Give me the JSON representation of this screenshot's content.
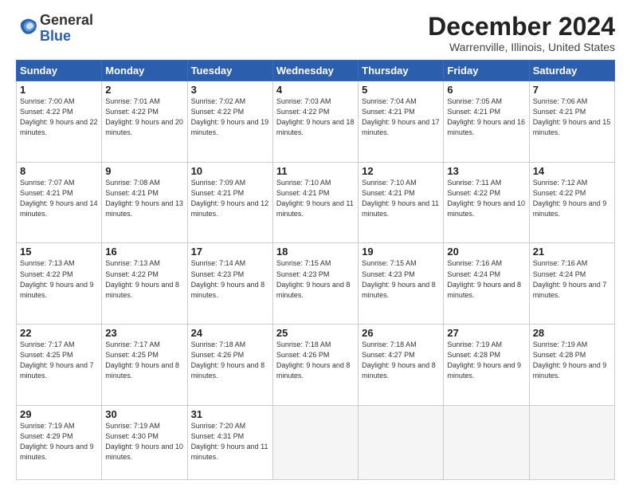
{
  "logo": {
    "general": "General",
    "blue": "Blue"
  },
  "title": "December 2024",
  "subtitle": "Warrenville, Illinois, United States",
  "headers": [
    "Sunday",
    "Monday",
    "Tuesday",
    "Wednesday",
    "Thursday",
    "Friday",
    "Saturday"
  ],
  "weeks": [
    [
      {
        "day": "1",
        "sunrise": "7:00 AM",
        "sunset": "4:22 PM",
        "daylight": "9 hours and 22 minutes."
      },
      {
        "day": "2",
        "sunrise": "7:01 AM",
        "sunset": "4:22 PM",
        "daylight": "9 hours and 20 minutes."
      },
      {
        "day": "3",
        "sunrise": "7:02 AM",
        "sunset": "4:22 PM",
        "daylight": "9 hours and 19 minutes."
      },
      {
        "day": "4",
        "sunrise": "7:03 AM",
        "sunset": "4:22 PM",
        "daylight": "9 hours and 18 minutes."
      },
      {
        "day": "5",
        "sunrise": "7:04 AM",
        "sunset": "4:21 PM",
        "daylight": "9 hours and 17 minutes."
      },
      {
        "day": "6",
        "sunrise": "7:05 AM",
        "sunset": "4:21 PM",
        "daylight": "9 hours and 16 minutes."
      },
      {
        "day": "7",
        "sunrise": "7:06 AM",
        "sunset": "4:21 PM",
        "daylight": "9 hours and 15 minutes."
      }
    ],
    [
      {
        "day": "8",
        "sunrise": "7:07 AM",
        "sunset": "4:21 PM",
        "daylight": "9 hours and 14 minutes."
      },
      {
        "day": "9",
        "sunrise": "7:08 AM",
        "sunset": "4:21 PM",
        "daylight": "9 hours and 13 minutes."
      },
      {
        "day": "10",
        "sunrise": "7:09 AM",
        "sunset": "4:21 PM",
        "daylight": "9 hours and 12 minutes."
      },
      {
        "day": "11",
        "sunrise": "7:10 AM",
        "sunset": "4:21 PM",
        "daylight": "9 hours and 11 minutes."
      },
      {
        "day": "12",
        "sunrise": "7:10 AM",
        "sunset": "4:21 PM",
        "daylight": "9 hours and 11 minutes."
      },
      {
        "day": "13",
        "sunrise": "7:11 AM",
        "sunset": "4:22 PM",
        "daylight": "9 hours and 10 minutes."
      },
      {
        "day": "14",
        "sunrise": "7:12 AM",
        "sunset": "4:22 PM",
        "daylight": "9 hours and 9 minutes."
      }
    ],
    [
      {
        "day": "15",
        "sunrise": "7:13 AM",
        "sunset": "4:22 PM",
        "daylight": "9 hours and 9 minutes."
      },
      {
        "day": "16",
        "sunrise": "7:13 AM",
        "sunset": "4:22 PM",
        "daylight": "9 hours and 8 minutes."
      },
      {
        "day": "17",
        "sunrise": "7:14 AM",
        "sunset": "4:23 PM",
        "daylight": "9 hours and 8 minutes."
      },
      {
        "day": "18",
        "sunrise": "7:15 AM",
        "sunset": "4:23 PM",
        "daylight": "9 hours and 8 minutes."
      },
      {
        "day": "19",
        "sunrise": "7:15 AM",
        "sunset": "4:23 PM",
        "daylight": "9 hours and 8 minutes."
      },
      {
        "day": "20",
        "sunrise": "7:16 AM",
        "sunset": "4:24 PM",
        "daylight": "9 hours and 8 minutes."
      },
      {
        "day": "21",
        "sunrise": "7:16 AM",
        "sunset": "4:24 PM",
        "daylight": "9 hours and 7 minutes."
      }
    ],
    [
      {
        "day": "22",
        "sunrise": "7:17 AM",
        "sunset": "4:25 PM",
        "daylight": "9 hours and 7 minutes."
      },
      {
        "day": "23",
        "sunrise": "7:17 AM",
        "sunset": "4:25 PM",
        "daylight": "9 hours and 8 minutes."
      },
      {
        "day": "24",
        "sunrise": "7:18 AM",
        "sunset": "4:26 PM",
        "daylight": "9 hours and 8 minutes."
      },
      {
        "day": "25",
        "sunrise": "7:18 AM",
        "sunset": "4:26 PM",
        "daylight": "9 hours and 8 minutes."
      },
      {
        "day": "26",
        "sunrise": "7:18 AM",
        "sunset": "4:27 PM",
        "daylight": "9 hours and 8 minutes."
      },
      {
        "day": "27",
        "sunrise": "7:19 AM",
        "sunset": "4:28 PM",
        "daylight": "9 hours and 9 minutes."
      },
      {
        "day": "28",
        "sunrise": "7:19 AM",
        "sunset": "4:28 PM",
        "daylight": "9 hours and 9 minutes."
      }
    ],
    [
      {
        "day": "29",
        "sunrise": "7:19 AM",
        "sunset": "4:29 PM",
        "daylight": "9 hours and 9 minutes."
      },
      {
        "day": "30",
        "sunrise": "7:19 AM",
        "sunset": "4:30 PM",
        "daylight": "9 hours and 10 minutes."
      },
      {
        "day": "31",
        "sunrise": "7:20 AM",
        "sunset": "4:31 PM",
        "daylight": "9 hours and 11 minutes."
      },
      null,
      null,
      null,
      null
    ]
  ]
}
